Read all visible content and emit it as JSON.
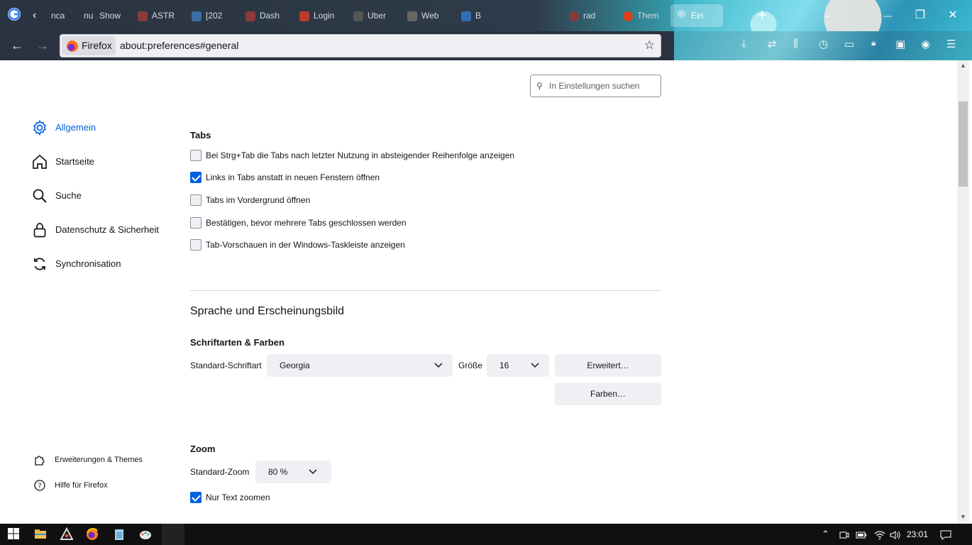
{
  "tabstrip": {
    "tabs": [
      {
        "label": "nca"
      },
      {
        "label": "nu"
      },
      {
        "label": "Show"
      },
      {
        "label": "ASTR"
      },
      {
        "label": "[202"
      },
      {
        "label": "Dash"
      },
      {
        "label": "Login"
      },
      {
        "label": "Uber"
      },
      {
        "label": "Web"
      },
      {
        "label": "B"
      },
      {
        "label": "rad"
      },
      {
        "label": "Them"
      },
      {
        "label": "Ein"
      }
    ],
    "new_tab": "+",
    "list_all": "⌄",
    "minimize": "—",
    "maximize": "❐",
    "close": "✕"
  },
  "navbar": {
    "back": "←",
    "forward": "→",
    "identity_label": "Firefox",
    "url": "about:preferences#general",
    "bookmark_star": "☆"
  },
  "search": {
    "placeholder": "In Einstellungen suchen",
    "icon": "⚲"
  },
  "categories": [
    {
      "label": "Allgemein",
      "icon": "gear-icon"
    },
    {
      "label": "Startseite",
      "icon": "home-icon"
    },
    {
      "label": "Suche",
      "icon": "search-icon"
    },
    {
      "label": "Datenschutz & Sicherheit",
      "icon": "lock-icon"
    },
    {
      "label": "Synchronisation",
      "icon": "sync-icon"
    }
  ],
  "footer_links": [
    {
      "label": "Erweiterungen & Themes",
      "icon": "puzzle-icon"
    },
    {
      "label": "Hilfe für Firefox",
      "icon": "help-icon"
    }
  ],
  "tabs_section": {
    "title": "Tabs",
    "options": [
      {
        "label": "Bei Strg+Tab die Tabs nach letzter Nutzung in absteigender Reihenfolge anzeigen",
        "checked": false
      },
      {
        "label": "Links in Tabs anstatt in neuen Fenstern öffnen",
        "checked": true
      },
      {
        "label": "Tabs im Vordergrund öffnen",
        "checked": false
      },
      {
        "label": "Bestätigen, bevor mehrere Tabs geschlossen werden",
        "checked": false
      },
      {
        "label": "Tab-Vorschauen in der Windows-Taskleiste anzeigen",
        "checked": false
      }
    ]
  },
  "language_section": {
    "title": "Sprache und Erscheinungsbild"
  },
  "fonts": {
    "title": "Schriftarten & Farben",
    "default_font_label": "Standard-Schriftart",
    "default_font_value": "Georgia",
    "size_label": "Größe",
    "size_value": "16",
    "advanced_button": "Erweitert…",
    "colors_button": "Farben…"
  },
  "zoom": {
    "title": "Zoom",
    "default_zoom_label": "Standard-Zoom",
    "default_zoom_value": "80 %",
    "text_only_label": "Nur Text zoomen",
    "text_only_checked": true
  },
  "taskbar": {
    "clock": "23:01",
    "tray_arrow": "⌃"
  },
  "colors": {
    "accent": "#0061e0",
    "text": "#15141a"
  }
}
